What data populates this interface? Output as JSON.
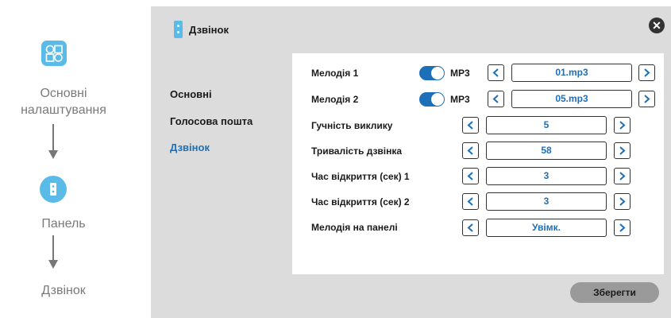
{
  "breadcrumb": {
    "items": [
      {
        "label": "Основні налаштування",
        "icon": "grid-settings-icon"
      },
      {
        "label": "Панель",
        "icon": "door-panel-icon"
      },
      {
        "label": "Дзвінок"
      }
    ]
  },
  "header": {
    "title": "Дзвінок",
    "icon": "door-panel-icon",
    "close_icon": "close-icon"
  },
  "menu": {
    "items": [
      {
        "label": "Основні",
        "active": false
      },
      {
        "label": "Голосова пошта",
        "active": false
      },
      {
        "label": "Дзвінок",
        "active": true
      }
    ]
  },
  "settings": {
    "rows": [
      {
        "label": "Мелодія 1",
        "toggle": true,
        "toggle_label": "MP3",
        "value": "01.mp3"
      },
      {
        "label": "Мелодія 2",
        "toggle": true,
        "toggle_label": "MP3",
        "value": "05.mp3"
      },
      {
        "label": "Гучність виклику",
        "value": "5"
      },
      {
        "label": "Тривалість дзвінка",
        "value": "58"
      },
      {
        "label": "Час відкриття (сек) 1",
        "value": "3"
      },
      {
        "label": "Час відкриття (сек) 2",
        "value": "3"
      },
      {
        "label": "Мелодія на панелі",
        "value": "Увімк."
      }
    ]
  },
  "save_label": "Зберегти",
  "colors": {
    "accent": "#1d6fb8",
    "icon_blue": "#5bbbe8",
    "panel_bg": "#dcdcdc"
  }
}
